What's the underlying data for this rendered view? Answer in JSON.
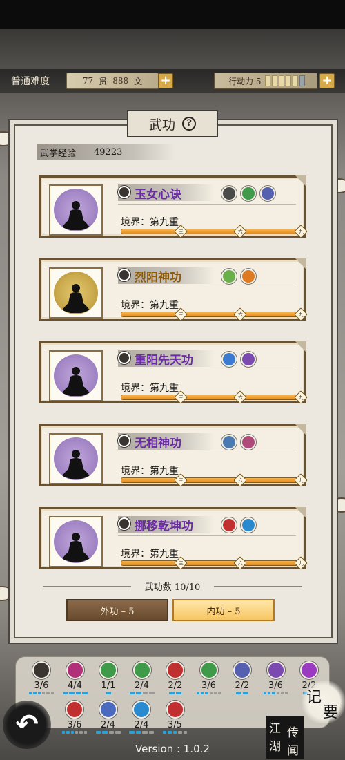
{
  "header": {
    "difficulty": "普通难度",
    "money": {
      "guan": "77",
      "guan_unit": "贯",
      "wen": "888",
      "wen_unit": "文"
    },
    "energy_label": "行动力 5",
    "energy_segments": [
      true,
      true,
      true,
      true,
      true,
      false
    ]
  },
  "panel": {
    "title": "武功",
    "help_icon": "?",
    "exp_label": "武学经验",
    "exp_value": "49223"
  },
  "skills": [
    {
      "name": "玉女心诀",
      "color": "purple",
      "realm": "境界：第九重",
      "tags": [
        {
          "color": "#4a4a4a"
        },
        {
          "color": "#3f9a4a"
        },
        {
          "color": "#5560b0"
        }
      ],
      "progress": 1.0
    },
    {
      "name": "烈阳神功",
      "color": "gold",
      "realm": "境界：第九重",
      "tags": [
        {
          "color": "#6ab04a"
        },
        {
          "color": "#e07a20"
        }
      ],
      "progress": 1.0
    },
    {
      "name": "重阳先天功",
      "color": "purple",
      "realm": "境界：第九重",
      "tags": [
        {
          "color": "#3a7ad0"
        },
        {
          "color": "#7a4ab0"
        }
      ],
      "progress": 1.0
    },
    {
      "name": "无相神功",
      "color": "purple",
      "realm": "境界：第九重",
      "tags": [
        {
          "color": "#4a7ab0"
        },
        {
          "color": "#b04a7a"
        }
      ],
      "progress": 1.0
    },
    {
      "name": "挪移乾坤功",
      "color": "purple",
      "realm": "境界：第九重",
      "tags": [
        {
          "color": "#c03030"
        },
        {
          "color": "#2a8ad0"
        }
      ],
      "progress": 1.0
    }
  ],
  "progress_marks": [
    "三",
    "六",
    "九"
  ],
  "count_text": "武功数 10/10",
  "tabs": {
    "outer": "外功 – 5",
    "inner": "内功 – 5"
  },
  "slots_row1": [
    {
      "count": "3/6",
      "color": "#3a3530",
      "pips": [
        1,
        1,
        1,
        0,
        0,
        0
      ]
    },
    {
      "count": "4/4",
      "color": "#b0307a",
      "pips": [
        1,
        1,
        1,
        1
      ]
    },
    {
      "count": "1/1",
      "color": "#3f9a4a",
      "pips": [
        1
      ]
    },
    {
      "count": "2/4",
      "color": "#3f9a4a",
      "pips": [
        1,
        1,
        0,
        0
      ]
    },
    {
      "count": "2/2",
      "color": "#c03030",
      "pips": [
        1,
        1
      ]
    },
    {
      "count": "3/6",
      "color": "#3f9a4a",
      "pips": [
        1,
        1,
        1,
        0,
        0,
        0
      ]
    },
    {
      "count": "2/2",
      "color": "#5560b0",
      "pips": [
        1,
        1
      ]
    },
    {
      "count": "3/6",
      "color": "#7a4ab0",
      "pips": [
        1,
        1,
        1,
        0,
        0,
        0
      ]
    },
    {
      "count": "2/2",
      "color": "#9a3ac0",
      "pips": [
        1,
        1
      ]
    }
  ],
  "slots_row2": [
    {
      "count": "3/6",
      "color": "#c03030",
      "pips": [
        1,
        1,
        1,
        0,
        0,
        0
      ]
    },
    {
      "count": "2/4",
      "color": "#4a6ac0",
      "pips": [
        1,
        1,
        0,
        0
      ]
    },
    {
      "count": "2/4",
      "color": "#2a8ad0",
      "pips": [
        1,
        1,
        0,
        0
      ]
    },
    {
      "count": "3/5",
      "color": "#c03030",
      "pips": [
        1,
        1,
        1,
        0,
        0
      ]
    }
  ],
  "buttons": {
    "back": "↶",
    "record_1": "记",
    "record_2": "要",
    "jh_1": "江",
    "jh_2": "湖",
    "jh_3": "传",
    "jh_4": "闻"
  },
  "version": "Version : 1.0.2"
}
